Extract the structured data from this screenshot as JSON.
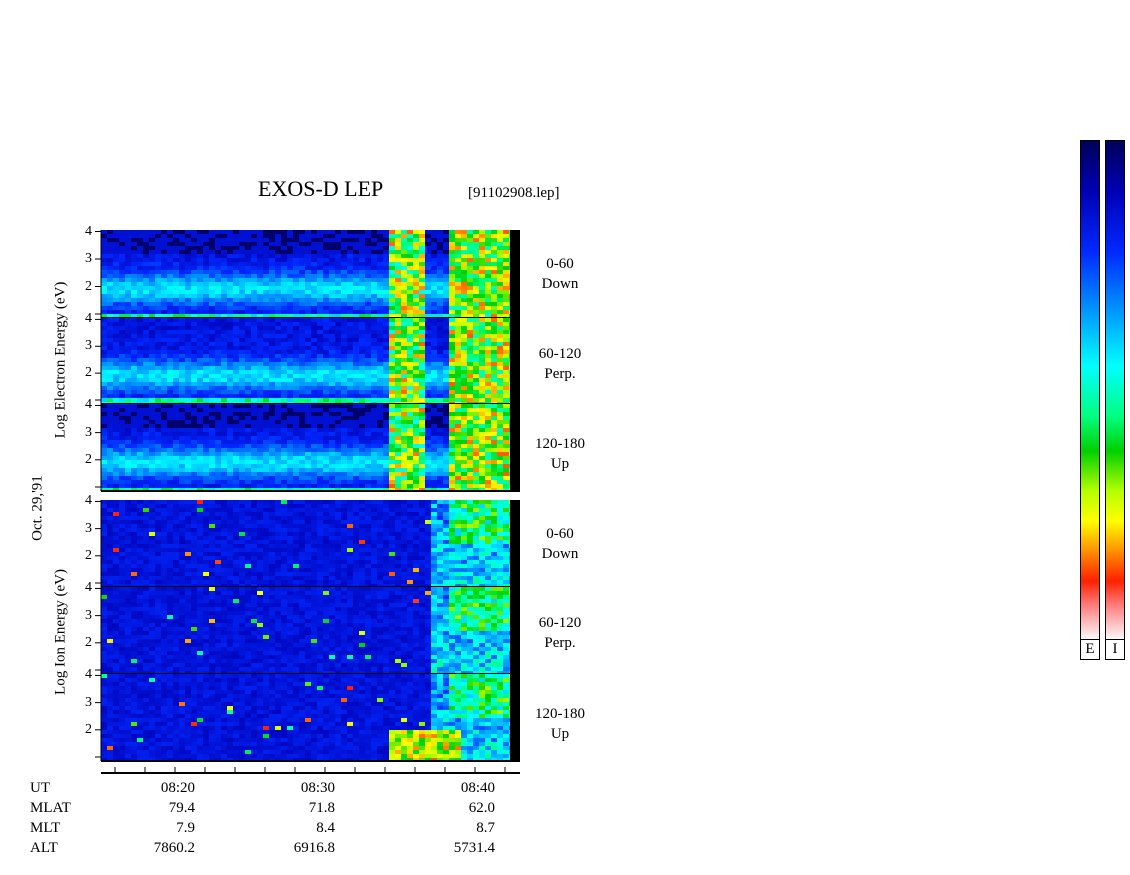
{
  "header": {
    "title": "EXOS-D LEP",
    "file": "[91102908.lep]"
  },
  "axis": {
    "electron_label": "Log  Electron  Energy (eV)",
    "ion_label": "Log  Ion  Energy (eV)",
    "date_label": "Oct. 29,'91",
    "y_ticks": [
      "4",
      "3",
      "2"
    ],
    "y_ticks_bottom": [
      "4",
      "3",
      "2"
    ]
  },
  "panels": [
    {
      "range": "0-60",
      "dir": "Down"
    },
    {
      "range": "60-120",
      "dir": "Perp."
    },
    {
      "range": "120-180",
      "dir": "Up"
    },
    {
      "range": "0-60",
      "dir": "Down"
    },
    {
      "range": "60-120",
      "dir": "Perp."
    },
    {
      "range": "120-180",
      "dir": "Up"
    }
  ],
  "colorbars": {
    "electron_caption": "E",
    "ion_caption": "I"
  },
  "chart_data": {
    "type": "heatmap",
    "title": "EXOS-D LEP",
    "ylabel_electron": "Log Electron Energy (eV)",
    "ylabel_ion": "Log Ion Energy (eV)",
    "ylim": [
      1,
      4
    ],
    "y_ticks": [
      2,
      3,
      4
    ],
    "x_ticks": [
      "08:20",
      "08:30",
      "08:40"
    ],
    "ephemeris": {
      "rows": [
        {
          "label": "UT",
          "values": [
            "08:20",
            "08:30",
            "08:40"
          ]
        },
        {
          "label": "MLAT",
          "values": [
            "79.4",
            "71.8",
            "62.0"
          ]
        },
        {
          "label": "MLT",
          "values": [
            "7.9",
            "8.4",
            "8.7"
          ]
        },
        {
          "label": "ALT",
          "values": [
            "7860.2",
            "6916.8",
            "5731.4"
          ]
        }
      ]
    }
  }
}
